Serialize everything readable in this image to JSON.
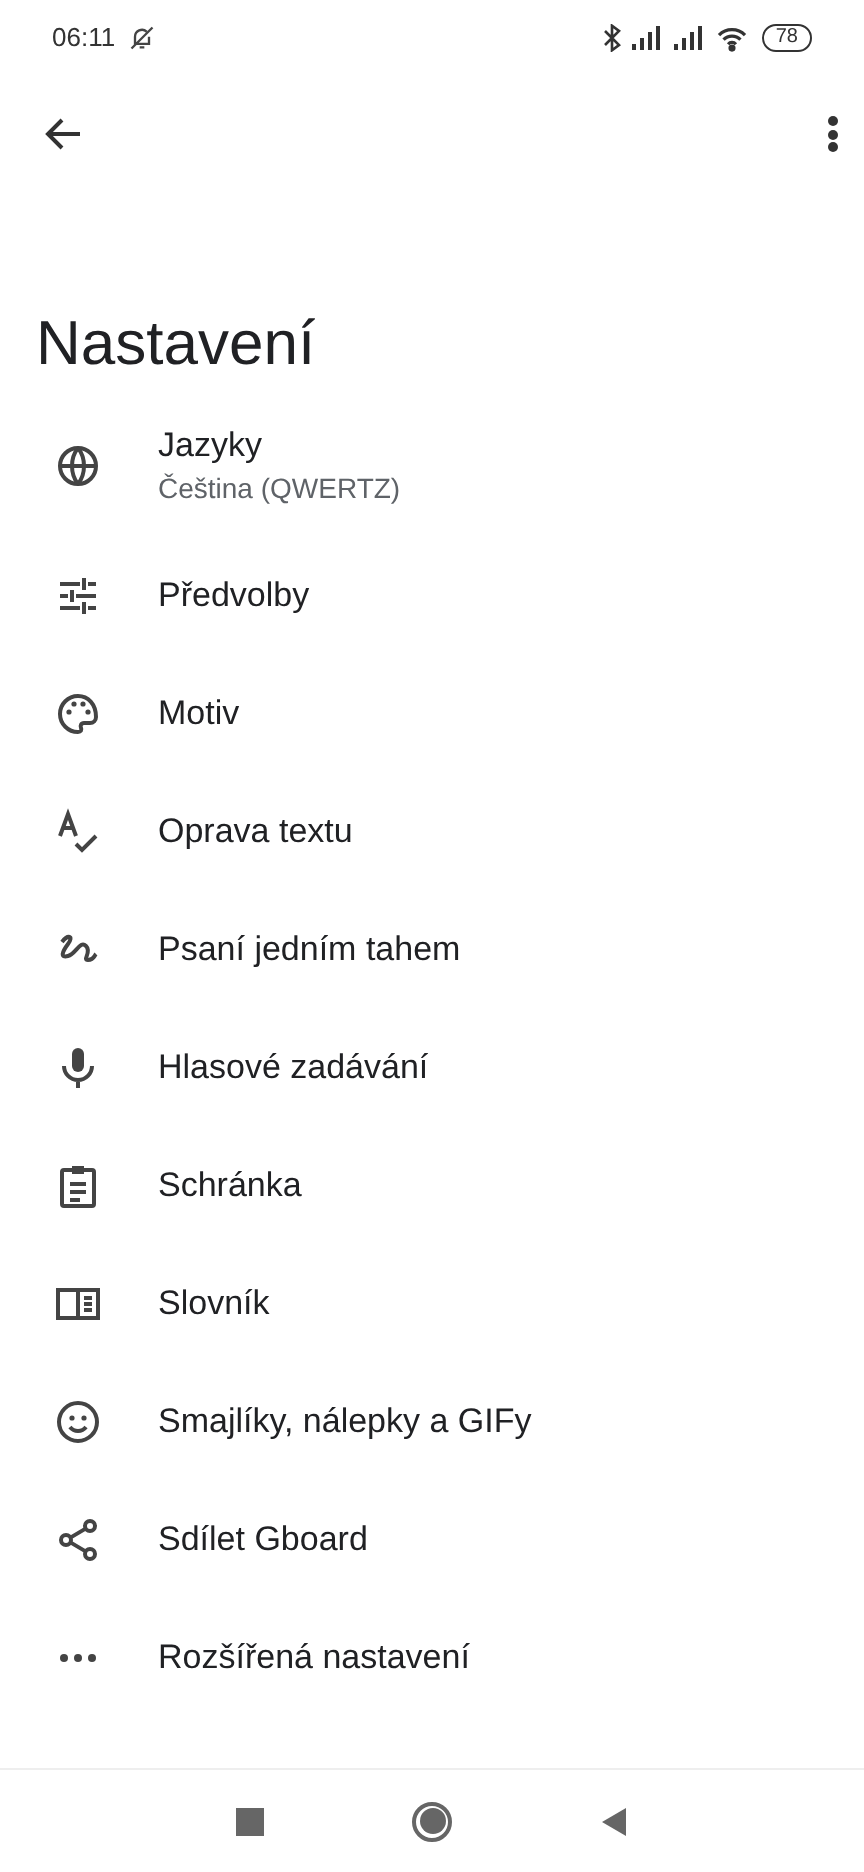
{
  "status_bar": {
    "time": "06:11",
    "battery": "78"
  },
  "title": "Nastavení",
  "items": [
    {
      "kind": "globe",
      "label": "Jazyky",
      "subtitle": "Čeština (QWERTZ)"
    },
    {
      "kind": "sliders",
      "label": "Předvolby"
    },
    {
      "kind": "palette",
      "label": "Motiv"
    },
    {
      "kind": "spellcheck",
      "label": "Oprava textu"
    },
    {
      "kind": "gesture",
      "label": "Psaní jedním tahem"
    },
    {
      "kind": "mic",
      "label": "Hlasové zadávání"
    },
    {
      "kind": "clipboard",
      "label": "Schránka"
    },
    {
      "kind": "book",
      "label": "Slovník"
    },
    {
      "kind": "smiley",
      "label": "Smajlíky, nálepky a GIFy"
    },
    {
      "kind": "share",
      "label": "Sdílet Gboard"
    },
    {
      "kind": "more",
      "label": "Rozšířená nastavení"
    }
  ]
}
